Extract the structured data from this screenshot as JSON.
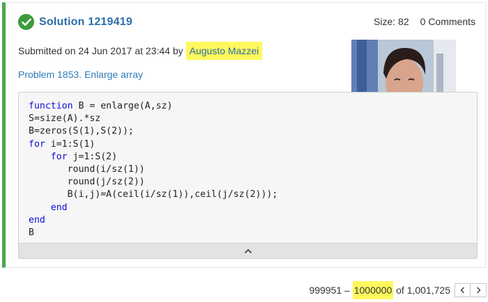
{
  "solution": {
    "title": "Solution 1219419",
    "size_label": "Size: 82",
    "comments_label": "0 Comments",
    "submitted_prefix": "Submitted on 24 Jun 2017 at 23:44 by",
    "author": "Augusto Mazzei",
    "problem_link": "Problem 1853. Enlarge array",
    "status_color": "#4aa74a",
    "highlight_color": "#fff85c"
  },
  "code": {
    "lines": [
      [
        {
          "t": "function",
          "k": true
        },
        {
          "t": " B = enlarge(A,sz)"
        }
      ],
      [
        {
          "t": "S=size(A).*sz"
        }
      ],
      [
        {
          "t": "B=zeros(S(1),S(2));"
        }
      ],
      [
        {
          "t": "for",
          "k": true
        },
        {
          "t": " i=1:S(1)"
        }
      ],
      [
        {
          "t": "    "
        },
        {
          "t": "for",
          "k": true
        },
        {
          "t": " j=1:S(2)"
        }
      ],
      [
        {
          "t": "       round(i/sz(1))"
        }
      ],
      [
        {
          "t": "       round(j/sz(2))"
        }
      ],
      [
        {
          "t": "       B(i,j)=A(ceil(i/sz(1)),ceil(j/sz(2)));"
        }
      ],
      [
        {
          "t": "    "
        },
        {
          "t": "end",
          "k": true
        }
      ],
      [
        {
          "t": "end",
          "k": true
        }
      ],
      [
        {
          "t": "B"
        }
      ]
    ],
    "collapse_icon": "chevron-up-icon"
  },
  "pager": {
    "start": "999951",
    "dash": " – ",
    "end": "1000000",
    "of_text": " of 1,001,725",
    "prev_icon": "chevron-left-icon",
    "next_icon": "chevron-right-icon"
  }
}
